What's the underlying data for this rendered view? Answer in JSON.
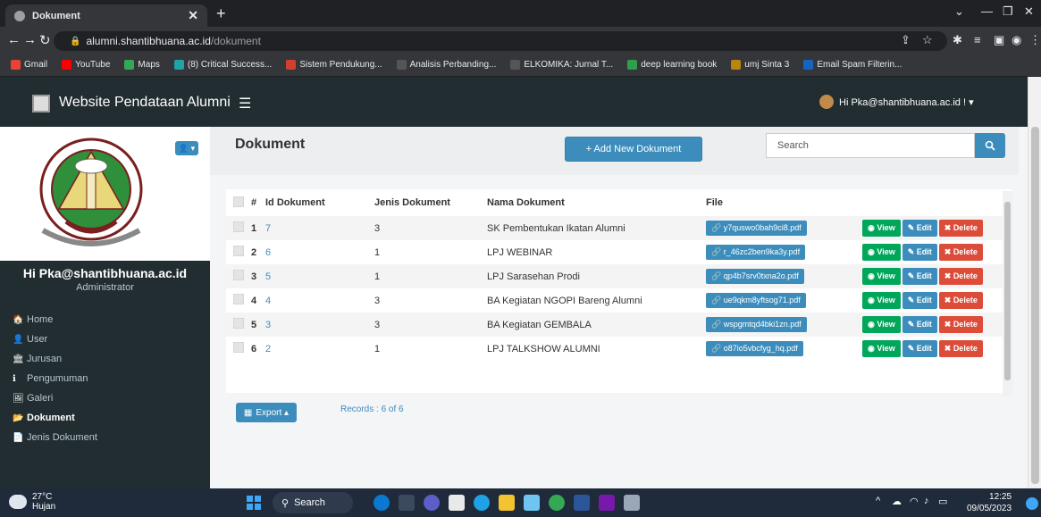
{
  "browser": {
    "tab_title": "Dokument",
    "url_host": "alumni.shantibhuana.ac.id",
    "url_path": "/dokument",
    "bookmarks": [
      {
        "label": "Gmail",
        "color": "#ea4335"
      },
      {
        "label": "YouTube",
        "color": "#ff0000"
      },
      {
        "label": "Maps",
        "color": "#34a853"
      },
      {
        "label": "(8) Critical Success...",
        "color": "#1fa2a8"
      },
      {
        "label": "Sistem Pendukung...",
        "color": "#d23f31"
      },
      {
        "label": "Analisis Perbanding...",
        "color": "#555555"
      },
      {
        "label": "ELKOMIKA: Jurnal T...",
        "color": "#555555"
      },
      {
        "label": "deep learning book",
        "color": "#2e9f4a"
      },
      {
        "label": "umj Sinta 3",
        "color": "#b8860b"
      },
      {
        "label": "Email Spam Filterin...",
        "color": "#1565c0"
      }
    ]
  },
  "header": {
    "brand": "Website Pendataan Alumni",
    "user_menu": "Hi Pka@shantibhuana.ac.id ! ▾"
  },
  "sidebar": {
    "user_name": "Hi Pka@shantibhuana.ac.id",
    "user_role": "Administrator",
    "items": [
      {
        "label": "Home",
        "icon": "home-icon",
        "glyph": "🏠"
      },
      {
        "label": "User",
        "icon": "user-icon",
        "glyph": "👤"
      },
      {
        "label": "Jurusan",
        "icon": "bank-icon",
        "glyph": "🏛"
      },
      {
        "label": "Pengumuman",
        "icon": "info-icon",
        "glyph": "ℹ"
      },
      {
        "label": "Galeri",
        "icon": "image-icon",
        "glyph": "🖼"
      },
      {
        "label": "Dokument",
        "icon": "folder-icon",
        "glyph": "📂"
      },
      {
        "label": "Jenis Dokument",
        "icon": "file-icon",
        "glyph": "📄"
      }
    ]
  },
  "content": {
    "title": "Dokument",
    "add_button": "+ Add New Dokument",
    "search_placeholder": "Search",
    "columns": [
      "#",
      "Id Dokument",
      "Jenis Dokument",
      "Nama Dokument",
      "File"
    ],
    "rows": [
      {
        "no": "1",
        "id": "7",
        "jenis": "3",
        "nama": "SK Pembentukan Ikatan Alumni",
        "file": "y7quswo0bah9ci8.pdf"
      },
      {
        "no": "2",
        "id": "6",
        "jenis": "1",
        "nama": "LPJ WEBINAR",
        "file": "r_46zc2ben9ka3y.pdf"
      },
      {
        "no": "3",
        "id": "5",
        "jenis": "1",
        "nama": "LPJ Sarasehan Prodi",
        "file": "qp4b7srv0txna2o.pdf"
      },
      {
        "no": "4",
        "id": "4",
        "jenis": "3",
        "nama": "BA Kegiatan NGOPI Bareng Alumni",
        "file": "ue9qkm8yftsog71.pdf"
      },
      {
        "no": "5",
        "id": "3",
        "jenis": "3",
        "nama": "BA Kegiatan GEMBALA",
        "file": "wspgmtqd4bki1zn.pdf"
      },
      {
        "no": "6",
        "id": "2",
        "jenis": "1",
        "nama": "LPJ TALKSHOW ALUMNI",
        "file": "o87io5vbcfyg_hq.pdf"
      }
    ],
    "actions": {
      "view": "View",
      "edit": "Edit",
      "delete": "Delete"
    },
    "export_button": "Export ▴",
    "records": "Records : 6 of 6"
  },
  "taskbar": {
    "temp": "27°C",
    "weather": "Hujan",
    "search": "Search",
    "time": "12:25",
    "date": "09/05/2023"
  }
}
